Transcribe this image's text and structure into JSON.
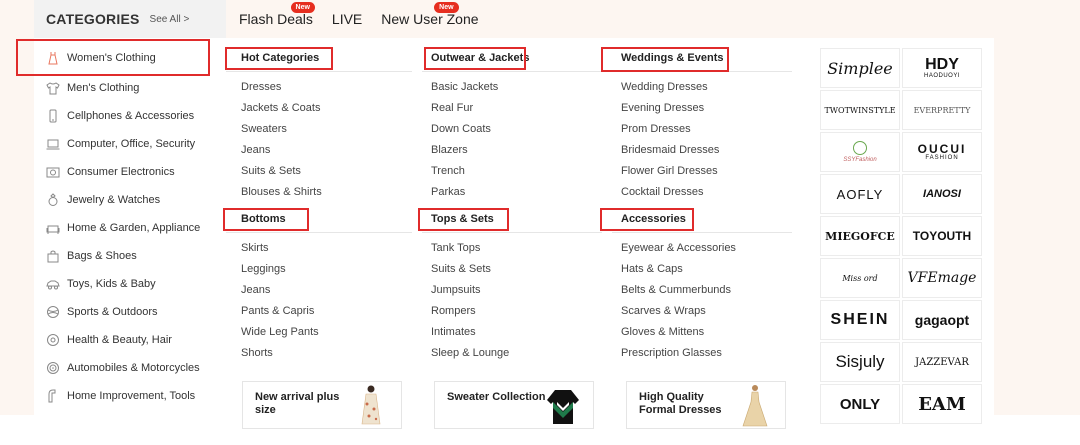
{
  "header": {
    "categories_title": "CATEGORIES",
    "see_all": "See All >",
    "nav": [
      {
        "label": "Flash Deals",
        "badge": "New"
      },
      {
        "label": "LIVE",
        "badge": ""
      },
      {
        "label": "New User Zone",
        "badge": "New"
      }
    ]
  },
  "sidebar": {
    "items": [
      {
        "label": "Women's Clothing",
        "icon": "dress-icon"
      },
      {
        "label": "Men's Clothing",
        "icon": "shirt-icon"
      },
      {
        "label": "Cellphones & Accessories",
        "icon": "phone-icon"
      },
      {
        "label": "Computer, Office, Security",
        "icon": "laptop-icon"
      },
      {
        "label": "Consumer Electronics",
        "icon": "camera-icon"
      },
      {
        "label": "Jewelry & Watches",
        "icon": "ring-icon"
      },
      {
        "label": "Home & Garden, Appliance",
        "icon": "sofa-icon"
      },
      {
        "label": "Bags & Shoes",
        "icon": "bag-icon"
      },
      {
        "label": "Toys, Kids & Baby",
        "icon": "car-toy-icon"
      },
      {
        "label": "Sports & Outdoors",
        "icon": "ball-icon"
      },
      {
        "label": "Health & Beauty, Hair",
        "icon": "beauty-icon"
      },
      {
        "label": "Automobiles & Motorcycles",
        "icon": "wheel-icon"
      },
      {
        "label": "Home Improvement, Tools",
        "icon": "tools-icon"
      }
    ]
  },
  "menu": {
    "groups": [
      {
        "title": "Hot Categories",
        "items": [
          "Dresses",
          "Jackets & Coats",
          "Sweaters",
          "Jeans",
          "Suits & Sets",
          "Blouses & Shirts"
        ]
      },
      {
        "title": "Outwear & Jackets",
        "items": [
          "Basic Jackets",
          "Real Fur",
          "Down Coats",
          "Blazers",
          "Trench",
          "Parkas"
        ]
      },
      {
        "title": "Weddings & Events",
        "items": [
          "Wedding Dresses",
          "Evening Dresses",
          "Prom Dresses",
          "Bridesmaid Dresses",
          "Flower Girl Dresses",
          "Cocktail Dresses"
        ]
      },
      {
        "title": "Bottoms",
        "items": [
          "Skirts",
          "Leggings",
          "Jeans",
          "Pants & Capris",
          "Wide Leg Pants",
          "Shorts"
        ]
      },
      {
        "title": "Tops & Sets",
        "items": [
          "Tank Tops",
          "Suits & Sets",
          "Jumpsuits",
          "Rompers",
          "Intimates",
          "Sleep & Lounge"
        ]
      },
      {
        "title": "Accessories",
        "items": [
          "Eyewear & Accessories",
          "Hats & Caps",
          "Belts & Cummerbunds",
          "Scarves & Wraps",
          "Gloves & Mittens",
          "Prescription Glasses"
        ]
      }
    ]
  },
  "promos": [
    {
      "line1": "New arrival plus",
      "line2": "size"
    },
    {
      "line1": "Sweater Collection",
      "line2": ""
    },
    {
      "line1": "High Quality",
      "line2": "Formal Dresses"
    }
  ],
  "brands": [
    "Simplee",
    "HDY",
    "TWOTWINSTYLE",
    "EVERPRETTY",
    "SSYFashion",
    "OUCUI",
    "AOFLY",
    "IANOSI",
    "MIEGOFCE",
    "TOYOUTH",
    "Miss ord",
    "VFEmage",
    "SHEIN",
    "gagaopt",
    "Sisjuly",
    "JAZZEVAR",
    "ONLY",
    "EAM"
  ],
  "brand_sub": {
    "hdy": "HAODUOYI",
    "oucui": "FASHION"
  },
  "colors": {
    "accent_red": "#e62e1f",
    "highlight_box": "#e02b2b",
    "top_band": "#fdf6f1"
  }
}
